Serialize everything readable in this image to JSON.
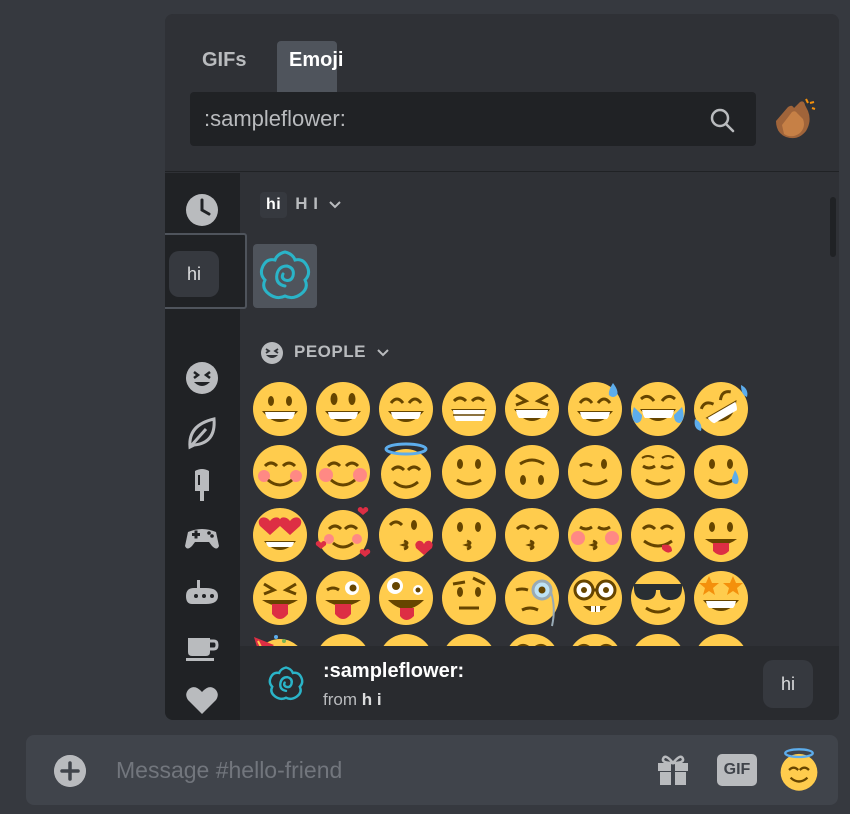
{
  "picker": {
    "tabs": [
      {
        "label": "GIFs",
        "active": false
      },
      {
        "label": "Emoji",
        "active": true
      }
    ],
    "search": {
      "value": ":sampleflower:",
      "icon": "search-icon"
    },
    "skin_tone_icon": "clapping-hands-icon",
    "sidebar": {
      "items": [
        {
          "icon": "clock-icon",
          "name": "recent"
        },
        {
          "label": "hi",
          "name": "server-hi",
          "selected": true
        },
        {
          "icon": "smiley-icon",
          "name": "people"
        },
        {
          "icon": "leaf-icon",
          "name": "nature"
        },
        {
          "icon": "popsicle-icon",
          "name": "food"
        },
        {
          "icon": "gamepad-icon",
          "name": "activities"
        },
        {
          "icon": "submarine-icon",
          "name": "travel"
        },
        {
          "icon": "coffee-icon",
          "name": "objects"
        },
        {
          "icon": "heart-icon",
          "name": "symbols"
        }
      ]
    },
    "categories": {
      "server": {
        "tag": "hi",
        "label": "H I"
      },
      "people": {
        "label": "PEOPLE"
      }
    },
    "custom_emoji_name": "sampleflower",
    "preview": {
      "name": ":sampleflower:",
      "from_prefix": "from ",
      "from_server": "h i",
      "server_badge": "hi"
    }
  },
  "message_bar": {
    "placeholder": "Message #hello-friend",
    "gif_label": "GIF"
  },
  "colors": {
    "background": "#36393f",
    "picker": "#2f3136",
    "sidebar": "#202225",
    "emoji_yellow": "#ffcc4d",
    "emoji_dark": "#664500",
    "flower_teal": "#2ab4c8"
  }
}
